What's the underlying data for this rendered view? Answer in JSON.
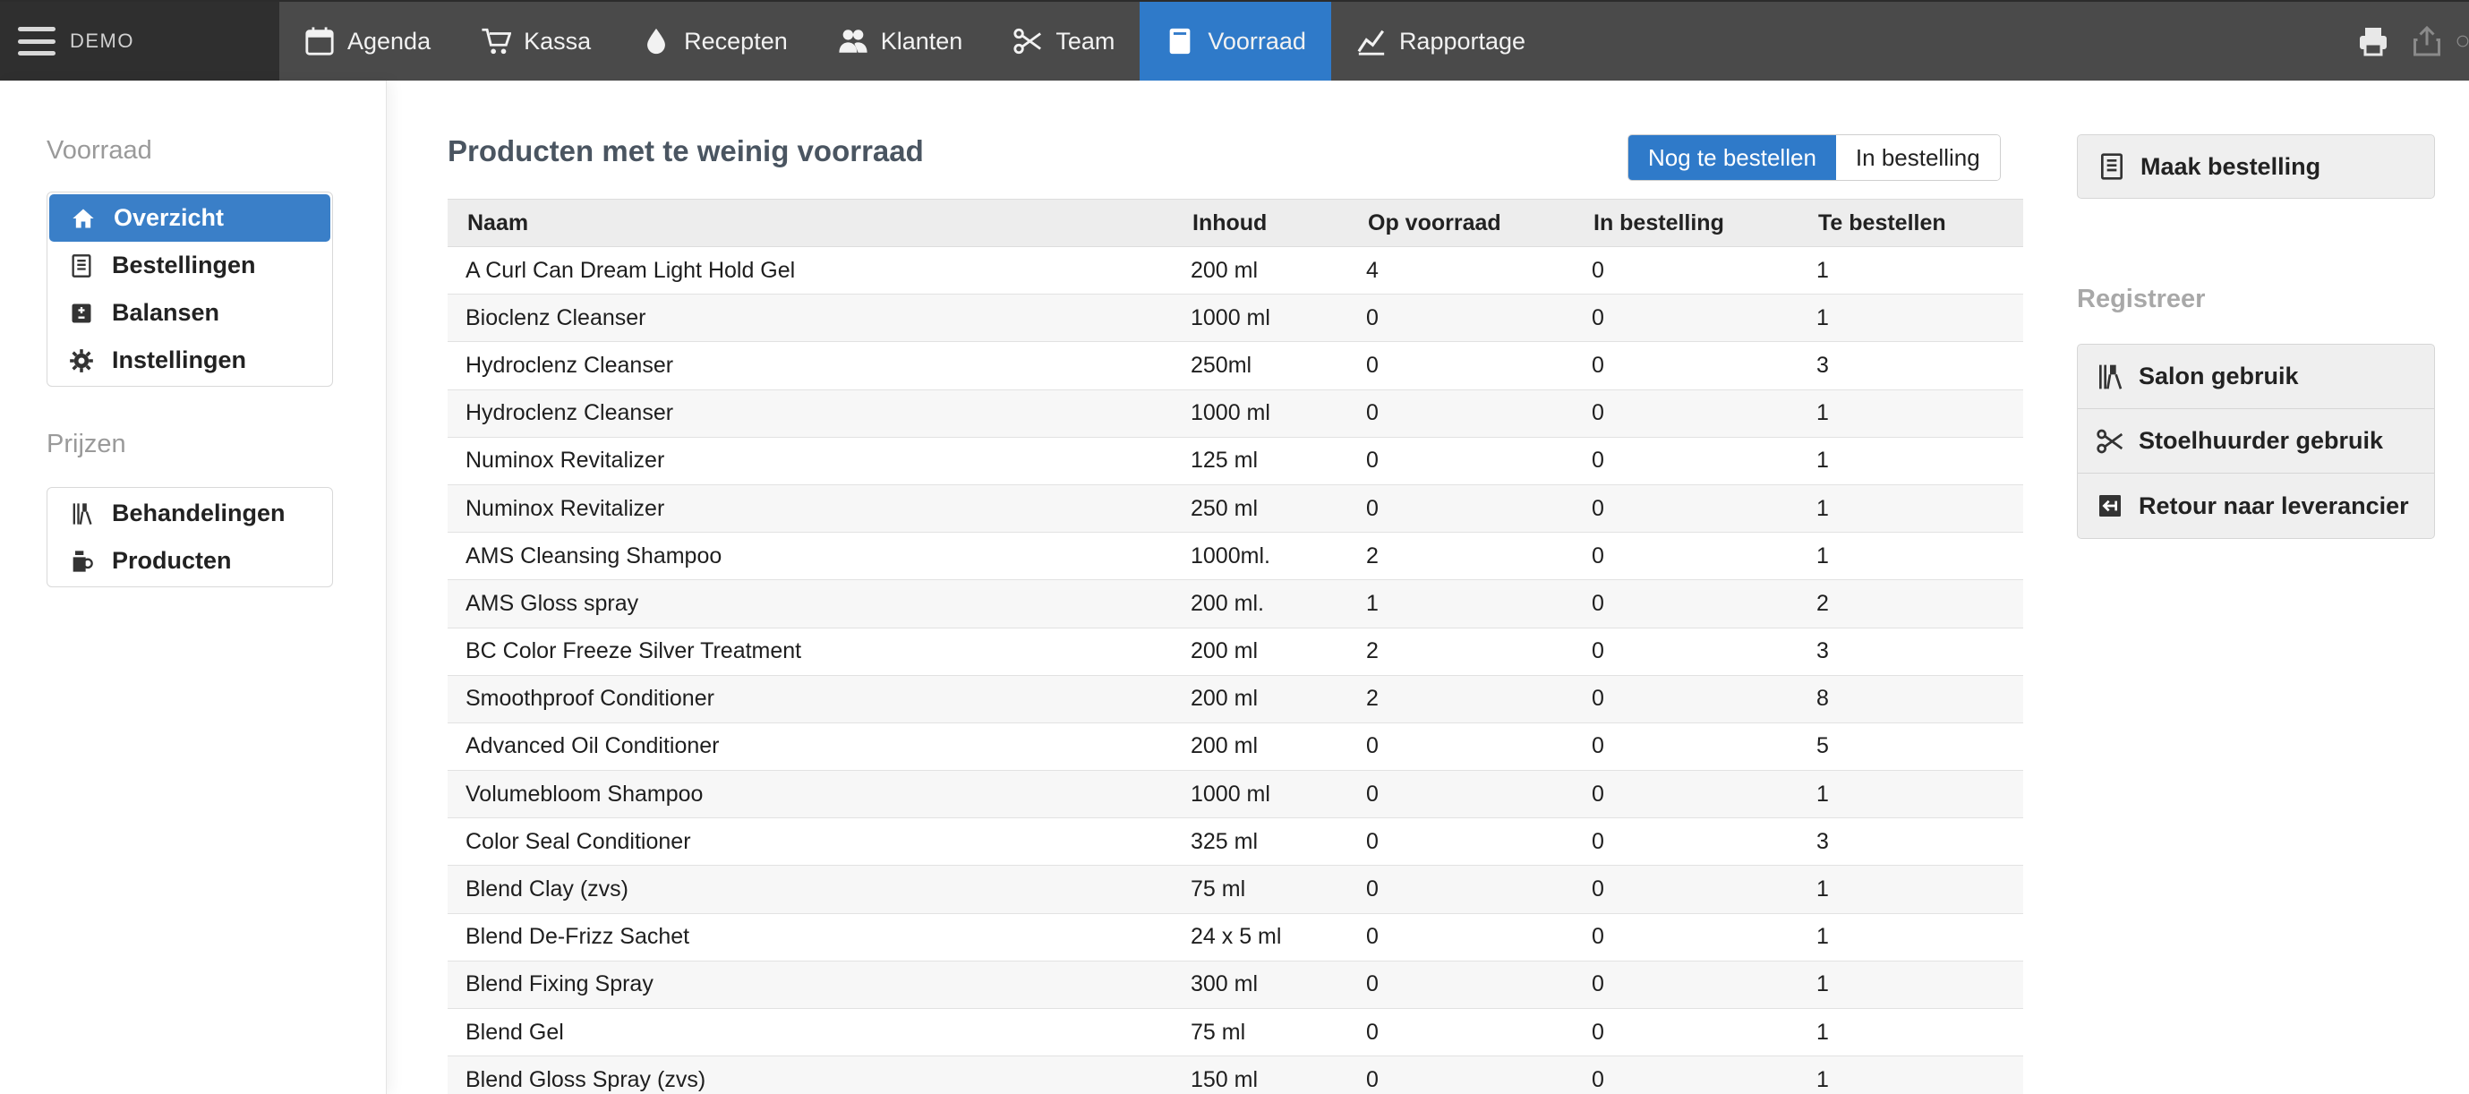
{
  "brand": {
    "label": "DEMO"
  },
  "nav": [
    {
      "label": "Agenda",
      "icon": "calendar-icon"
    },
    {
      "label": "Kassa",
      "icon": "cart-icon"
    },
    {
      "label": "Recepten",
      "icon": "drop-icon"
    },
    {
      "label": "Klanten",
      "icon": "users-icon"
    },
    {
      "label": "Team",
      "icon": "scissors-icon"
    },
    {
      "label": "Voorraad",
      "icon": "book-icon",
      "active": true
    },
    {
      "label": "Rapportage",
      "icon": "chart-line-icon"
    }
  ],
  "topbar_icons": [
    "print-icon",
    "share-icon"
  ],
  "sidebar": {
    "voorraad_heading": "Voorraad",
    "voorraad_items": [
      {
        "label": "Overzicht",
        "icon": "home-icon",
        "active": true
      },
      {
        "label": "Bestellingen",
        "icon": "list-icon"
      },
      {
        "label": "Balansen",
        "icon": "plus-minus-icon"
      },
      {
        "label": "Instellingen",
        "icon": "gear-icon"
      }
    ],
    "prijzen_heading": "Prijzen",
    "prijzen_items": [
      {
        "label": "Behandelingen",
        "icon": "treatment-icon"
      },
      {
        "label": "Producten",
        "icon": "product-icon"
      }
    ]
  },
  "main": {
    "title": "Producten met te weinig voorraad",
    "toggle": {
      "left": "Nog te bestellen",
      "right": "In bestelling",
      "active": "left"
    },
    "columns": [
      "Naam",
      "Inhoud",
      "Op voorraad",
      "In bestelling",
      "Te bestellen"
    ],
    "rows": [
      [
        "A Curl Can Dream Light Hold Gel",
        "200 ml",
        "4",
        "0",
        "1"
      ],
      [
        "Bioclenz Cleanser",
        "1000 ml",
        "0",
        "0",
        "1"
      ],
      [
        "Hydroclenz Cleanser",
        "250ml",
        "0",
        "0",
        "3"
      ],
      [
        "Hydroclenz Cleanser",
        "1000 ml",
        "0",
        "0",
        "1"
      ],
      [
        "Numinox Revitalizer",
        "125 ml",
        "0",
        "0",
        "1"
      ],
      [
        "Numinox Revitalizer",
        "250 ml",
        "0",
        "0",
        "1"
      ],
      [
        "AMS Cleansing Shampoo",
        "1000ml.",
        "2",
        "0",
        "1"
      ],
      [
        "AMS Gloss spray",
        "200 ml.",
        "1",
        "0",
        "2"
      ],
      [
        "BC Color Freeze Silver Treatment",
        "200 ml",
        "2",
        "0",
        "3"
      ],
      [
        "Smoothproof Conditioner",
        "200 ml",
        "2",
        "0",
        "8"
      ],
      [
        "Advanced Oil Conditioner",
        "200 ml",
        "0",
        "0",
        "5"
      ],
      [
        "Volumebloom Shampoo",
        "1000 ml",
        "0",
        "0",
        "1"
      ],
      [
        "Color Seal Conditioner",
        "325 ml",
        "0",
        "0",
        "3"
      ],
      [
        "Blend Clay (zvs)",
        "75 ml",
        "0",
        "0",
        "1"
      ],
      [
        "Blend De-Frizz Sachet",
        "24 x 5 ml",
        "0",
        "0",
        "1"
      ],
      [
        "Blend Fixing Spray",
        "300 ml",
        "0",
        "0",
        "1"
      ],
      [
        "Blend Gel",
        "75 ml",
        "0",
        "0",
        "1"
      ],
      [
        "Blend Gloss Spray (zvs)",
        "150 ml",
        "0",
        "0",
        "1"
      ]
    ]
  },
  "right": {
    "order_button": "Maak bestelling",
    "register_heading": "Registreer",
    "register_items": [
      {
        "label": "Salon gebruik",
        "icon": "salon-icon"
      },
      {
        "label": "Stoelhuurder gebruik",
        "icon": "scissors-icon"
      },
      {
        "label": "Retour naar leverancier",
        "icon": "return-icon"
      }
    ]
  },
  "colors": {
    "topbar": "#4a4a4a",
    "brand_bg": "#2f2f2f",
    "accent": "#2f7ac9"
  }
}
